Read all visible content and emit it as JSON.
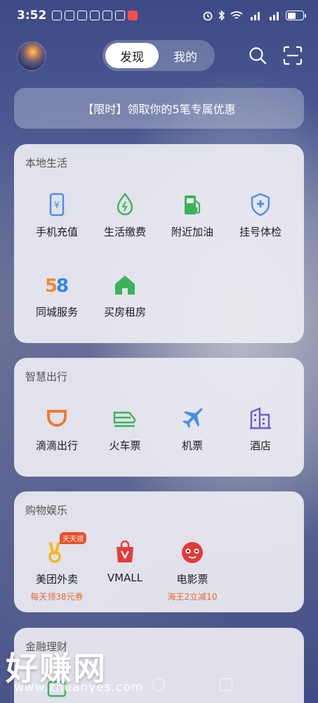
{
  "status_bar": {
    "time": "3:52",
    "notification_icons": [
      "vpn-icon",
      "message-icon",
      "alert-icon",
      "app-icon",
      "qq-icon",
      "calendar-icon",
      "red-app-icon"
    ],
    "system_icons": [
      "alarm-icon",
      "bluetooth-icon",
      "wifi-icon",
      "signal-4g-icon",
      "signal-4g-icon",
      "battery-icon"
    ],
    "battery_level": 0.55
  },
  "header": {
    "tabs": [
      {
        "label": "发现",
        "active": true
      },
      {
        "label": "我的",
        "active": false
      }
    ]
  },
  "promo": {
    "text": "【限时】领取你的5笔专属优惠"
  },
  "sections": [
    {
      "title": "本地生活",
      "items": [
        {
          "label": "手机充值",
          "icon": "phone-recharge-icon"
        },
        {
          "label": "生活缴费",
          "icon": "utility-bill-icon"
        },
        {
          "label": "附近加油",
          "icon": "gas-station-icon"
        },
        {
          "label": "挂号体检",
          "icon": "medical-shield-icon"
        },
        {
          "label": "同城服务",
          "icon": "58-logo-icon"
        },
        {
          "label": "买房租房",
          "icon": "house-icon"
        }
      ]
    },
    {
      "title": "智慧出行",
      "items": [
        {
          "label": "滴滴出行",
          "icon": "didi-icon"
        },
        {
          "label": "火车票",
          "icon": "train-icon"
        },
        {
          "label": "机票",
          "icon": "airplane-icon"
        },
        {
          "label": "酒店",
          "icon": "hotel-icon"
        }
      ]
    },
    {
      "title": "购物娱乐",
      "items": [
        {
          "label": "美团外卖",
          "icon": "meituan-icon",
          "sub": "每天领38元券",
          "badge": "天天领"
        },
        {
          "label": "VMALL",
          "icon": "vmall-bag-icon"
        },
        {
          "label": "电影票",
          "icon": "movie-cat-icon",
          "sub": "海王2立减10"
        }
      ]
    },
    {
      "title": "金融理财",
      "items": []
    }
  ],
  "colors": {
    "accent_orange": "#e46a2b",
    "blue_icon": "#4a8fe7",
    "green_icon": "#3bb35a",
    "purple_icon": "#6a5bd6"
  },
  "watermark": {
    "text": "好赚网",
    "url": "www.zhuanyes.com"
  }
}
